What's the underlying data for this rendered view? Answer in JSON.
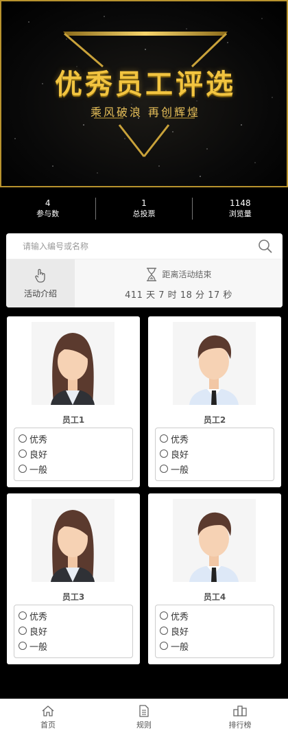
{
  "banner": {
    "title": "优秀员工评选",
    "subtitle": "乘风破浪 再创辉煌"
  },
  "stats": [
    {
      "value": "4",
      "label": "参与数"
    },
    {
      "value": "1",
      "label": "总投票"
    },
    {
      "value": "1148",
      "label": "浏览量"
    }
  ],
  "search": {
    "placeholder": "请输入编号或名称",
    "icon": "search-icon"
  },
  "intro": {
    "label": "活动介绍",
    "icon": "hand-pointer-icon"
  },
  "countdown": {
    "label": "距离活动结束",
    "icon": "hourglass-icon",
    "days": "411",
    "day_unit": "天",
    "hours": "7",
    "hour_unit": "时",
    "minutes": "18",
    "minute_unit": "分",
    "seconds": "17",
    "second_unit": "秒"
  },
  "employees": [
    {
      "name": "员工1",
      "avatar": "female-avatar",
      "options": [
        "优秀",
        "良好",
        "一般"
      ]
    },
    {
      "name": "员工2",
      "avatar": "male-avatar",
      "options": [
        "优秀",
        "良好",
        "一般"
      ]
    },
    {
      "name": "员工3",
      "avatar": "female-avatar",
      "options": [
        "优秀",
        "良好",
        "一般"
      ]
    },
    {
      "name": "员工4",
      "avatar": "male-avatar",
      "options": [
        "优秀",
        "良好",
        "一般"
      ]
    }
  ],
  "tabs": [
    {
      "label": "首页",
      "icon": "home-icon"
    },
    {
      "label": "规则",
      "icon": "document-icon"
    },
    {
      "label": "排行榜",
      "icon": "ranking-icon"
    }
  ],
  "colors": {
    "gold": "#f2c440",
    "frame": "#b8932e",
    "background": "#000000"
  }
}
